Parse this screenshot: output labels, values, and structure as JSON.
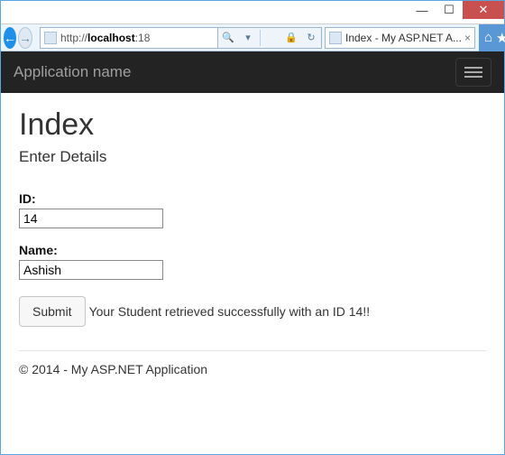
{
  "window": {
    "minimize_glyph": "—",
    "maximize_glyph": "☐",
    "close_glyph": "✕"
  },
  "ie_chrome": {
    "back_glyph": "←",
    "forward_glyph": "→",
    "url_prefix": "http://",
    "url_host": "localhost",
    "url_suffix": ":18",
    "search_glyph": "🔍",
    "dropdown_glyph": "▾",
    "lock_glyph": "🔒",
    "refresh_glyph": "↻",
    "tab_title": "Index - My ASP.NET A...",
    "tab_close_glyph": "×",
    "home_glyph": "⌂",
    "star_glyph": "★",
    "gear_glyph": "⚙"
  },
  "app": {
    "brand": "Application name",
    "page_title": "Index",
    "subtitle": "Enter Details",
    "id_label": "ID:",
    "id_value": "14",
    "name_label": "Name:",
    "name_value": "Ashish",
    "submit_label": "Submit",
    "result_message": "Your Student retrieved successfully with an ID 14!!",
    "footer": "© 2014 - My ASP.NET Application"
  }
}
